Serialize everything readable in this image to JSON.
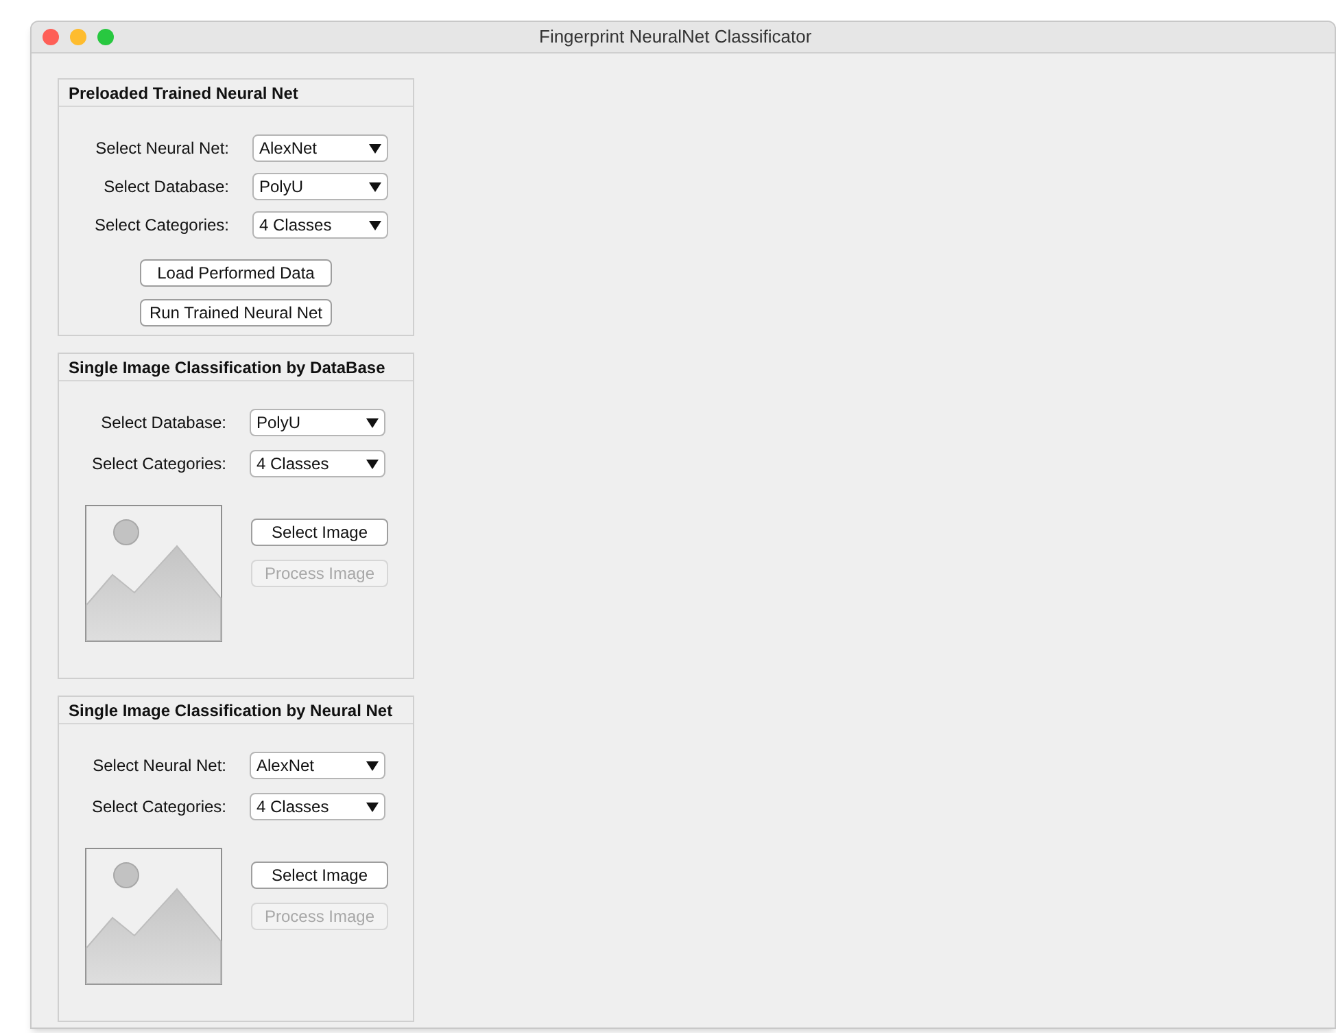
{
  "window": {
    "title": "Fingerprint NeuralNet Classificator"
  },
  "panels": [
    {
      "kind": "preloaded",
      "title": "Preloaded Trained Neural Net",
      "fields": [
        {
          "label": "Select Neural Net:",
          "value": "AlexNet"
        },
        {
          "label": "Select Database:",
          "value": "PolyU"
        },
        {
          "label": "Select Categories:",
          "value": "4 Classes"
        }
      ],
      "buttons": [
        {
          "label": "Load Performed Data",
          "disabled": false
        },
        {
          "label": "Run Trained Neural Net",
          "disabled": false
        }
      ]
    },
    {
      "kind": "single",
      "title": "Single Image Classification by DataBase",
      "fields": [
        {
          "label": "Select Database:",
          "value": "PolyU"
        },
        {
          "label": "Select Categories:",
          "value": "4 Classes"
        }
      ],
      "buttons": [
        {
          "label": "Select Image",
          "disabled": false
        },
        {
          "label": "Process Image",
          "disabled": true
        }
      ]
    },
    {
      "kind": "single",
      "title": "Single Image Classification by Neural Net",
      "fields": [
        {
          "label": "Select Neural Net:",
          "value": "AlexNet"
        },
        {
          "label": "Select Categories:",
          "value": "4 Classes"
        }
      ],
      "buttons": [
        {
          "label": "Select Image",
          "disabled": false
        },
        {
          "label": "Process Image",
          "disabled": true
        }
      ]
    }
  ]
}
